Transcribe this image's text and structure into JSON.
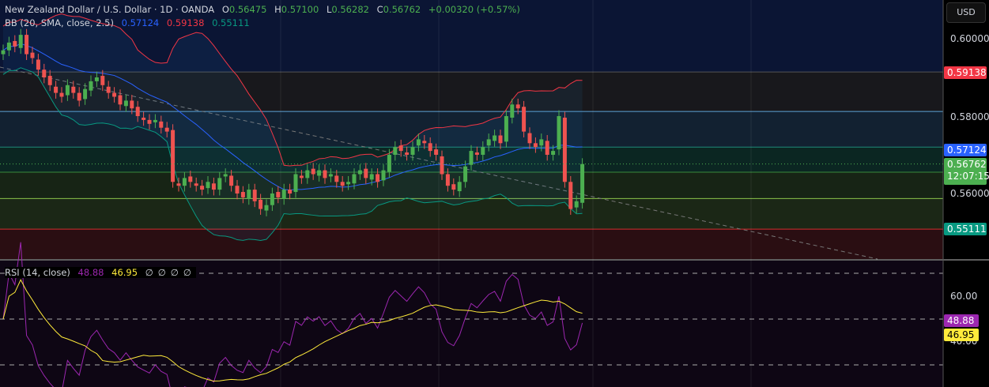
{
  "header": {
    "title": "New Zealand Dollar / U.S. Dollar · 1D · OANDA",
    "o_label": "O",
    "o": "0.56475",
    "h_label": "H",
    "h": "0.57100",
    "l_label": "L",
    "l": "0.56282",
    "c_label": "C",
    "c": "0.56762",
    "change": "+0.00320 (+0.57%)"
  },
  "bb": {
    "label": "BB (20, SMA, close, 2.5)",
    "basis": "0.57124",
    "upper": "0.59138",
    "lower": "0.55111"
  },
  "rsi": {
    "label": "RSI (14, close)",
    "value": "48.88",
    "ma": "46.95",
    "extras": [
      "∅",
      "∅",
      "∅",
      "∅"
    ]
  },
  "axis": {
    "currency": "USD",
    "price_ticks": [
      "0.60000",
      "0.58000",
      "0.56000"
    ],
    "rsi_ticks": [
      "60.00",
      "40.00"
    ],
    "last_price": "0.56762",
    "countdown": "12:07:15"
  },
  "colors": {
    "up": "#26a69a",
    "down": "#ef5350",
    "bb_basis": "#2962ff",
    "bb_upper": "#f23645",
    "bb_lower": "#089981",
    "rsi": "#9c27b0",
    "rsi_ma": "#ffeb3b"
  },
  "chart_data": {
    "type": "candlestick",
    "symbol": "NZDUSD",
    "timeframe": "1D",
    "ylim": [
      0.545,
      0.605
    ],
    "rsi_ylim": [
      20,
      80
    ],
    "closes": [
      0.597,
      0.599,
      0.598,
      0.601,
      0.596,
      0.595,
      0.592,
      0.59,
      0.588,
      0.586,
      0.585,
      0.588,
      0.586,
      0.584,
      0.587,
      0.589,
      0.59,
      0.588,
      0.586,
      0.585,
      0.583,
      0.584,
      0.582,
      0.58,
      0.579,
      0.578,
      0.579,
      0.577,
      0.576,
      0.563,
      0.562,
      0.564,
      0.563,
      0.562,
      0.561,
      0.563,
      0.561,
      0.564,
      0.565,
      0.562,
      0.56,
      0.559,
      0.561,
      0.558,
      0.556,
      0.557,
      0.56,
      0.559,
      0.561,
      0.56,
      0.565,
      0.564,
      0.566,
      0.565,
      0.566,
      0.564,
      0.565,
      0.563,
      0.562,
      0.563,
      0.565,
      0.566,
      0.564,
      0.565,
      0.563,
      0.566,
      0.57,
      0.572,
      0.571,
      0.57,
      0.572,
      0.574,
      0.573,
      0.571,
      0.57,
      0.565,
      0.562,
      0.561,
      0.563,
      0.567,
      0.571,
      0.57,
      0.572,
      0.574,
      0.575,
      0.573,
      0.58,
      0.583,
      0.582,
      0.576,
      0.573,
      0.572,
      0.574,
      0.57,
      0.571,
      0.58,
      0.563,
      0.556,
      0.558,
      0.56762
    ],
    "levels": [
      0.5914,
      0.5812,
      0.5719,
      0.5655,
      0.5587,
      0.5508
    ]
  }
}
